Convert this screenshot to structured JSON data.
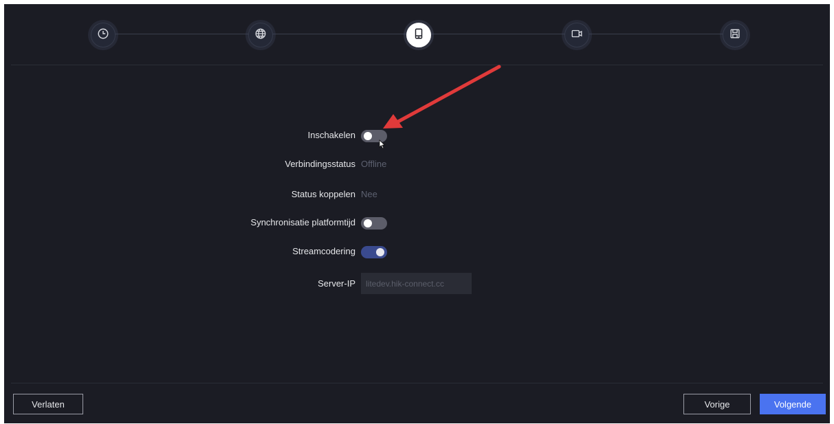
{
  "steps": [
    {
      "name": "clock-icon",
      "active": false
    },
    {
      "name": "globe-icon",
      "active": false
    },
    {
      "name": "mobile-device-icon",
      "active": true
    },
    {
      "name": "camera-icon",
      "active": false
    },
    {
      "name": "save-icon",
      "active": false
    }
  ],
  "form": {
    "enable_label": "Inschakelen",
    "enable_on": false,
    "connection_status_label": "Verbindingsstatus",
    "connection_status_value": "Offline",
    "bind_status_label": "Status koppelen",
    "bind_status_value": "Nee",
    "sync_time_label": "Synchronisatie platformtijd",
    "sync_time_on": false,
    "stream_encoding_label": "Streamcodering",
    "stream_encoding_on": true,
    "server_ip_label": "Server-IP",
    "server_ip_value": "litedev.hik-connect.cc"
  },
  "footer": {
    "exit_label": "Verlaten",
    "previous_label": "Vorige",
    "next_label": "Volgende"
  },
  "colors": {
    "background": "#1b1c24",
    "accent": "#4a73f0",
    "annotation_arrow": "#e03a3a"
  }
}
